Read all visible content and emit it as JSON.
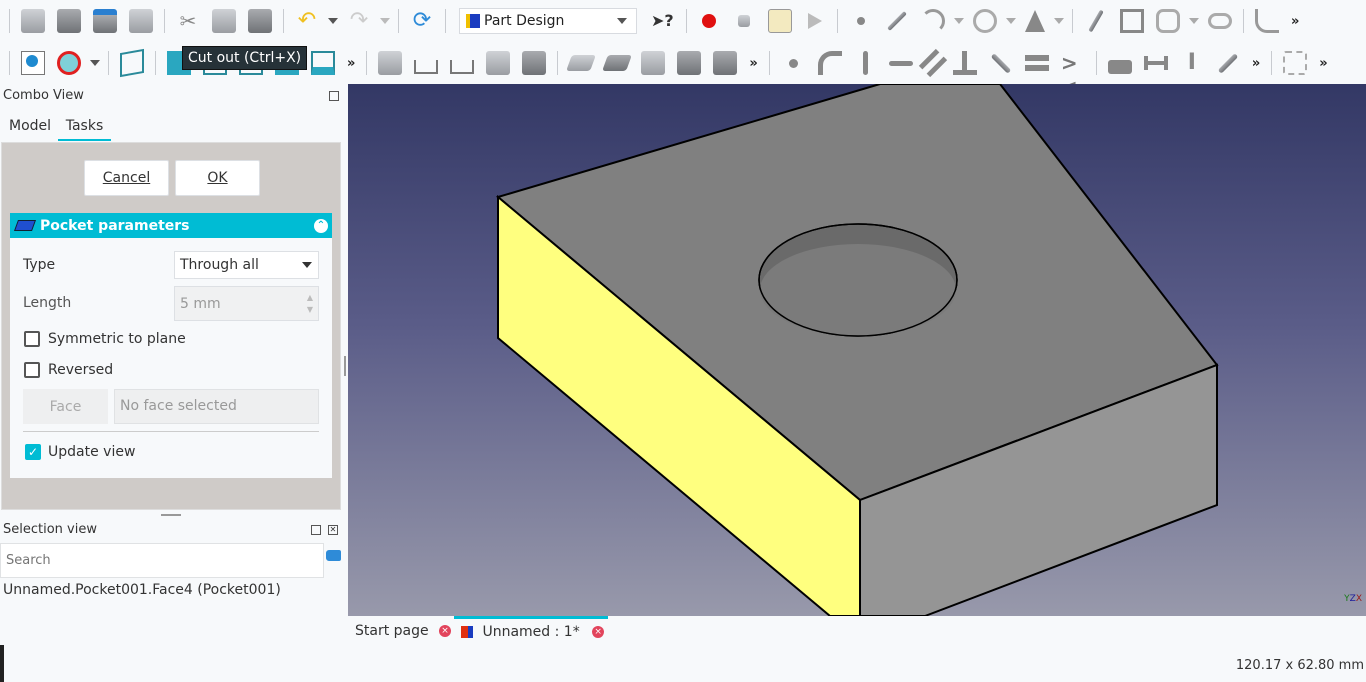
{
  "toolbar1": {
    "workbench": "Part Design",
    "icons": [
      "new-icon",
      "open-icon",
      "save-icon",
      "save-as-icon",
      "cut-icon",
      "copy-icon",
      "paste-icon",
      "undo-icon",
      "redo-icon",
      "refresh-icon",
      "whats-this-icon",
      "macro-record-icon",
      "macro-stop-icon",
      "macro-edit-icon",
      "macro-run-icon",
      "sketch-point-icon",
      "sketch-line-icon",
      "sketch-arc-icon",
      "sketch-circle-icon",
      "sketch-conic-icon",
      "sketch-polyline-icon",
      "sketch-rectangle-icon",
      "sketch-polygon-icon",
      "sketch-slot-icon",
      "sketch-fillet-icon"
    ]
  },
  "toolbar2": {
    "icons": [
      "fit-all-icon",
      "draw-style-icon",
      "isometric-icon",
      "front-view-icon",
      "top-view-icon",
      "right-view-icon",
      "rear-view-icon",
      "bottom-view-icon",
      "left-view-icon",
      "create-body-icon",
      "import-icon",
      "export-icon",
      "measure-icon",
      "part-icon",
      "pad-icon",
      "pocket-icon",
      "revolution-icon",
      "groove-icon",
      "additive-box-icon",
      "constrain-coincident-icon",
      "constrain-point-on-object-icon",
      "constrain-vertical-icon",
      "constrain-horizontal-icon",
      "constrain-parallel-icon",
      "constrain-perpendicular-icon",
      "constrain-tangent-icon",
      "constrain-equal-icon",
      "constrain-symmetric-icon",
      "constrain-lock-icon",
      "constrain-horizontal-distance-icon",
      "constrain-vertical-distance-icon",
      "constrain-distance-icon",
      "toggle-constraint-icon"
    ]
  },
  "tooltip": "Cut out (Ctrl+X)",
  "combo": {
    "title": "Combo View",
    "tabs": [
      "Model",
      "Tasks"
    ],
    "active_tab": "Tasks",
    "cancel": "Cancel",
    "ok": "OK"
  },
  "pocket": {
    "title": "Pocket parameters",
    "type_label": "Type",
    "type_value": "Through all",
    "length_label": "Length",
    "length_value": "5 mm",
    "symmetric_label": "Symmetric to plane",
    "symmetric": false,
    "reversed_label": "Reversed",
    "reversed": false,
    "face_button": "Face",
    "face_value": "No face selected",
    "update_label": "Update view",
    "update": true
  },
  "selection": {
    "title": "Selection view",
    "search_placeholder": "Search",
    "item": "Unnamed.Pocket001.Face4 (Pocket001)"
  },
  "doc_tabs": [
    {
      "label": "Start page"
    },
    {
      "label": "Unnamed : 1*",
      "active": true
    }
  ],
  "status": "120.17 x 62.80 mm",
  "axis": {
    "x": "X",
    "y": "Y",
    "z": "Z"
  },
  "colors": {
    "accent": "#00bcd4",
    "selected_face": "#ffff7f",
    "body": "#808080"
  }
}
